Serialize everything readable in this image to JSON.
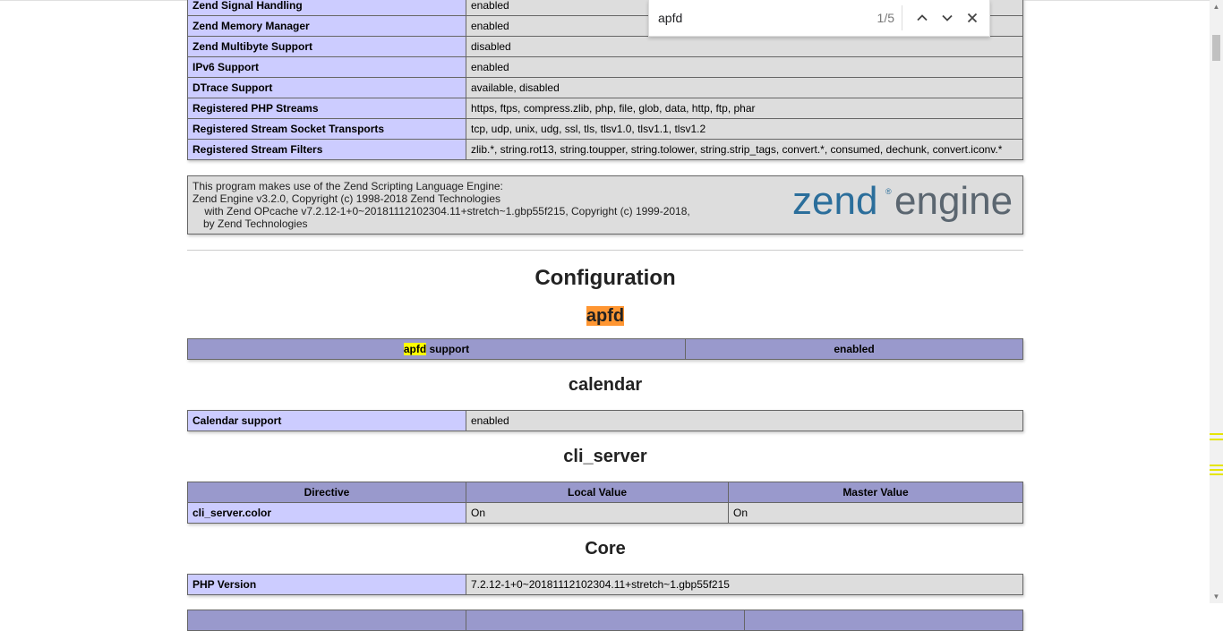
{
  "general_rows": [
    {
      "name": "Zend Signal Handling",
      "value": "enabled"
    },
    {
      "name": "Zend Memory Manager",
      "value": "enabled"
    },
    {
      "name": "Zend Multibyte Support",
      "value": "disabled"
    },
    {
      "name": "IPv6 Support",
      "value": "enabled"
    },
    {
      "name": "DTrace Support",
      "value": "available, disabled"
    },
    {
      "name": "Registered PHP Streams",
      "value": "https, ftps, compress.zlib, php, file, glob, data, http, ftp, phar"
    },
    {
      "name": "Registered Stream Socket Transports",
      "value": "tcp, udp, unix, udg, ssl, tls, tlsv1.0, tlsv1.1, tlsv1.2"
    },
    {
      "name": "Registered Stream Filters",
      "value": "zlib.*, string.rot13, string.toupper, string.tolower, string.strip_tags, convert.*, consumed, dechunk, convert.iconv.*"
    }
  ],
  "engine": {
    "line1": "This program makes use of the Zend Scripting Language Engine:",
    "line2": "Zend Engine v3.2.0, Copyright (c) 1998-2018 Zend Technologies",
    "line3": "with Zend OPcache v7.2.12-1+0~20181112102304.11+stretch~1.gbp55f215, Copyright (c) 1999-2018, by Zend Technologies",
    "logo_word1": "zend",
    "logo_word2": "engine",
    "logo_reg": "®"
  },
  "configuration_title": "Configuration",
  "apfd": {
    "title": "apfd",
    "header_left_mark": "apfd",
    "header_left_rest": " support",
    "header_right": "enabled"
  },
  "calendar": {
    "title": "calendar",
    "rows": [
      {
        "name": "Calendar support",
        "value": "enabled"
      }
    ]
  },
  "cli_server": {
    "title": "cli_server",
    "headers": [
      "Directive",
      "Local Value",
      "Master Value"
    ],
    "rows": [
      {
        "name": "cli_server.color",
        "local": "On",
        "master": "On"
      }
    ]
  },
  "core": {
    "title": "Core",
    "rows": [
      {
        "name": "PHP Version",
        "value": "7.2.12-1+0~20181112102304.11+stretch~1.gbp55f215"
      }
    ]
  },
  "find": {
    "query": "apfd",
    "count": "1/5",
    "prev_icon": "chevron-up-icon",
    "next_icon": "chevron-down-icon",
    "close_icon": "close-icon"
  },
  "colors": {
    "header_purple": "#9999cc",
    "label_lavender": "#ccccff",
    "value_gray": "#dddddd",
    "current_match": "#ff9632",
    "other_match": "#ffff00",
    "logo_blue": "#2b6e9b",
    "logo_gray": "#5b6670"
  }
}
